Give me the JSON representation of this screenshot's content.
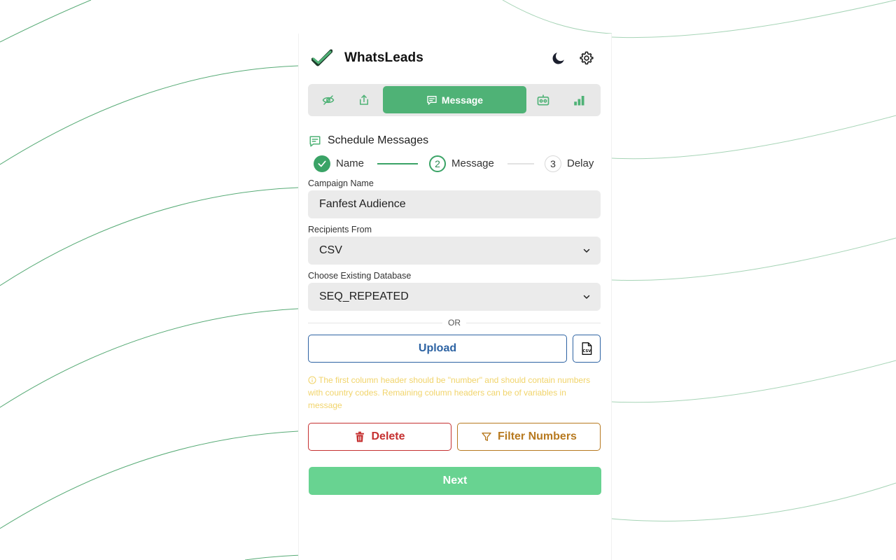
{
  "app": {
    "title": "WhatsLeads"
  },
  "colors": {
    "brand_green": "#4fb276",
    "next_green": "#68d391",
    "upload_blue": "#2d63a3",
    "delete_red": "#c53030",
    "filter_amber": "#b7791f",
    "hint_yellow": "#f1d46b"
  },
  "header": {
    "icons": [
      "moon-icon",
      "settings-gear-icon"
    ]
  },
  "tabs": [
    {
      "icon": "eye-off-icon",
      "label": ""
    },
    {
      "icon": "upload-share-icon",
      "label": ""
    },
    {
      "icon": "message-icon",
      "label": "Message",
      "active": true
    },
    {
      "icon": "bot-icon",
      "label": ""
    },
    {
      "icon": "bar-chart-icon",
      "label": ""
    }
  ],
  "section": {
    "title": "Schedule Messages",
    "icon": "message-square-icon"
  },
  "stepper": [
    {
      "num": "1",
      "label": "Name",
      "state": "done"
    },
    {
      "num": "2",
      "label": "Message",
      "state": "current"
    },
    {
      "num": "3",
      "label": "Delay",
      "state": "pending"
    }
  ],
  "form": {
    "campaign": {
      "label": "Campaign Name",
      "value": "Fanfest Audience"
    },
    "recipients": {
      "label": "Recipients From",
      "value": "CSV"
    },
    "database": {
      "label": "Choose Existing Database",
      "value": "SEQ_REPEATED"
    },
    "or_text": "OR",
    "upload_label": "Upload",
    "csv_icon": "csv-file-icon",
    "hint": "The first column header should be \"number\" and should contain numbers with country codes. Remaining column headers can be of variables in message"
  },
  "actions": {
    "delete_label": "Delete",
    "filter_label": "Filter Numbers",
    "next_label": "Next"
  }
}
